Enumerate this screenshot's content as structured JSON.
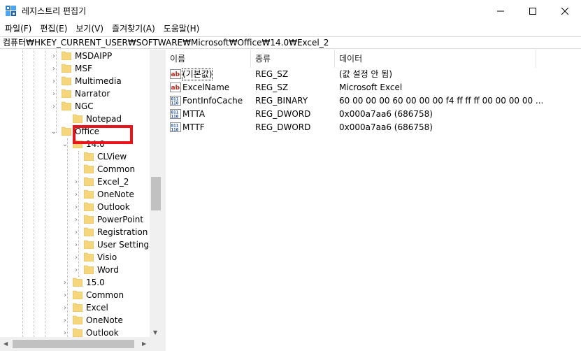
{
  "window": {
    "title": "레지스트리 편집기"
  },
  "menu": [
    {
      "label": "파일(F)"
    },
    {
      "label": "편집(E)"
    },
    {
      "label": "보기(V)"
    },
    {
      "label": "즐겨찾기(A)"
    },
    {
      "label": "도움말(H)"
    }
  ],
  "address": {
    "path": "컴퓨터₩HKEY_CURRENT_USER₩SOFTWARE₩Microsoft₩Office₩14.0₩Excel_2"
  },
  "tree": [
    {
      "label": "MSDAIPP",
      "expander": ">"
    },
    {
      "label": "MSF",
      "expander": ">"
    },
    {
      "label": "Multimedia",
      "expander": ">"
    },
    {
      "label": "Narrator",
      "expander": ">"
    },
    {
      "label": "NGC",
      "expander": ">"
    },
    {
      "label": "Notepad",
      "expander": ""
    },
    {
      "label": "Office",
      "expander": "v"
    },
    {
      "label": "14.0",
      "expander": "v"
    },
    {
      "label": "CLView",
      "expander": ""
    },
    {
      "label": "Common",
      "expander": ""
    },
    {
      "label": "Excel_2",
      "expander": ">"
    },
    {
      "label": "OneNote",
      "expander": ">"
    },
    {
      "label": "Outlook",
      "expander": ">"
    },
    {
      "label": "PowerPoint",
      "expander": ">"
    },
    {
      "label": "Registration",
      "expander": ">"
    },
    {
      "label": "User Settings",
      "expander": ">"
    },
    {
      "label": "Visio",
      "expander": ">"
    },
    {
      "label": "Word",
      "expander": ">"
    },
    {
      "label": "15.0",
      "expander": ">"
    },
    {
      "label": "Common",
      "expander": ">"
    },
    {
      "label": "Excel",
      "expander": ">"
    },
    {
      "label": "OneNote",
      "expander": ">"
    },
    {
      "label": "Outlook",
      "expander": ">"
    }
  ],
  "columns": [
    {
      "label": "이름"
    },
    {
      "label": "종류"
    },
    {
      "label": "데이터"
    }
  ],
  "values": [
    {
      "name": "(기본값)",
      "type": "REG_SZ",
      "data": "(값 설정 안 됨)",
      "icon": "string-value-icon"
    },
    {
      "name": "ExcelName",
      "type": "REG_SZ",
      "data": "Microsoft Excel",
      "icon": "string-value-icon"
    },
    {
      "name": "FontInfoCache",
      "type": "REG_BINARY",
      "data": "60 00 00 00 60 00 00 00 f4 ff ff ff 00 00 00 00 ...",
      "icon": "binary-value-icon"
    },
    {
      "name": "MTTA",
      "type": "REG_DWORD",
      "data": "0x000a7aa6 (686758)",
      "icon": "binary-value-icon"
    },
    {
      "name": "MTTF",
      "type": "REG_DWORD",
      "data": "0x000a7aa6 (686758)",
      "icon": "binary-value-icon"
    }
  ],
  "colors": {
    "selection_highlight": "#e8131b",
    "folder": "#f5d67a"
  }
}
